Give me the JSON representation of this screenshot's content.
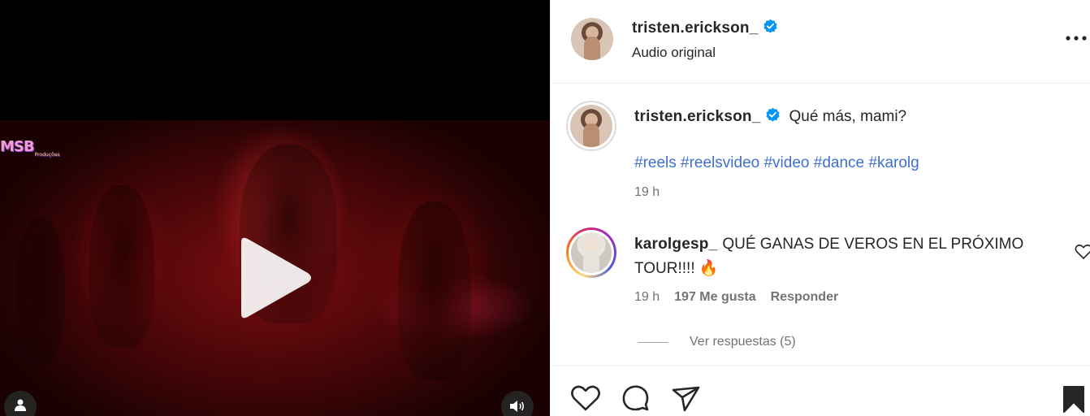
{
  "video": {
    "watermark_main": "MSB",
    "watermark_sub": "Produções"
  },
  "header": {
    "username": "tristen.erickson_",
    "audio_label": "Audio original"
  },
  "caption": {
    "username": "tristen.erickson_",
    "text": "Qué más, mami?",
    "hashtags": [
      "#reels",
      "#reelsvideo",
      "#video",
      "#dance",
      "#karolg"
    ],
    "time": "19 h"
  },
  "comment": {
    "username": "karolgesp_",
    "text": "QUÉ GANAS DE VEROS EN EL PRÓXIMO TOUR!!!! 🔥",
    "time": "19 h",
    "likes": "197 Me gusta",
    "reply_label": "Responder",
    "view_replies": "Ver respuestas (5)"
  },
  "icons": {
    "verified": "verified-badge-icon",
    "more": "more-options-icon",
    "play": "play-icon",
    "user_tag": "user-tag-icon",
    "audio": "speaker-icon",
    "like": "heart-icon",
    "comment": "comment-icon",
    "share": "send-icon",
    "save": "bookmark-icon"
  },
  "colors": {
    "verified": "#0095f6",
    "hashtag": "#3f6fd0",
    "secondary_text": "#737373"
  }
}
